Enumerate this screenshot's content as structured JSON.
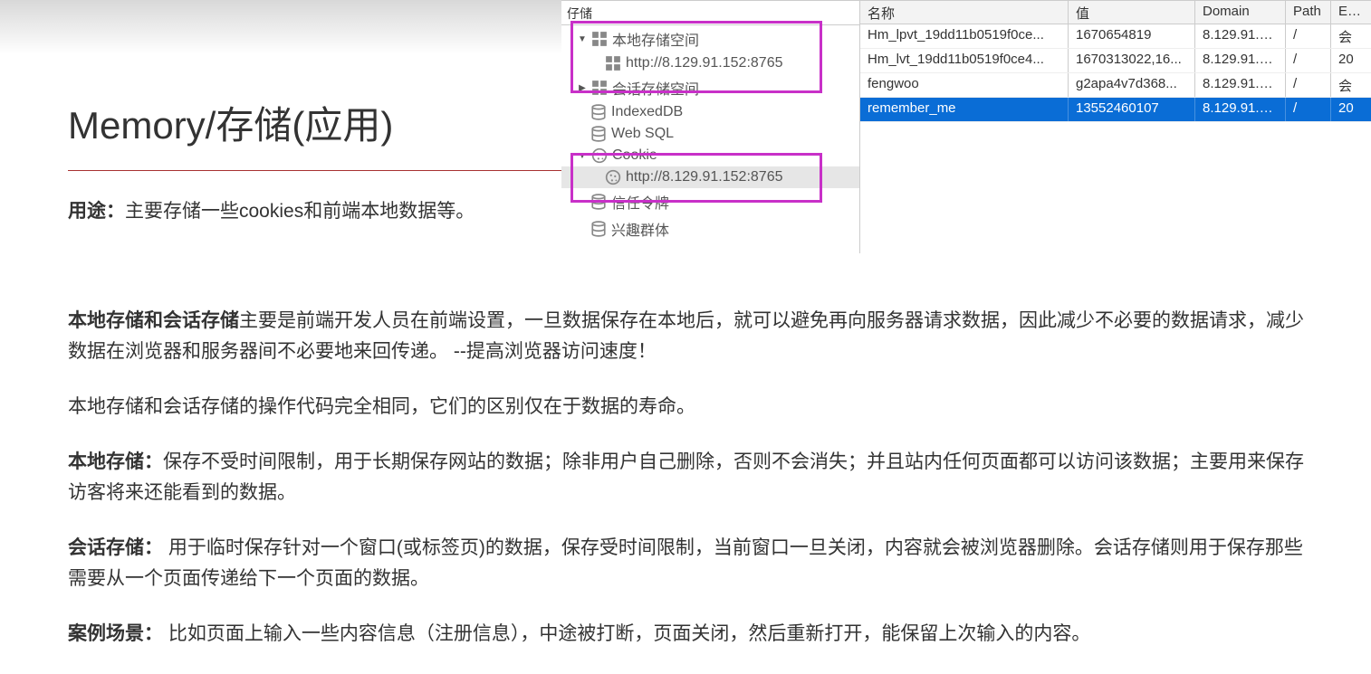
{
  "title": "Memory/存储(应用)",
  "paragraphs": {
    "p1_bold": "用途：",
    "p1_rest": "主要存储一些cookies和前端本地数据等。",
    "p2_bold": "本地存储和会话存储",
    "p2_rest": "主要是前端开发人员在前端设置，一旦数据保存在本地后，就可以避免再向服务器请求数据，因此减少不必要的数据请求，减少数据在浏览器和服务器间不必要地来回传递。 --提高浏览器访问速度！",
    "p3": "本地存储和会话存储的操作代码完全相同，它们的区别仅在于数据的寿命。",
    "p4_bold": "本地存储：",
    "p4_rest": "保存不受时间限制，用于长期保存网站的数据；除非用户自己删除，否则不会消失；并且站内任何页面都可以访问该数据；主要用来保存访客将来还能看到的数据。",
    "p5_bold": "会话存储：",
    "p5_rest": " 用于临时保存针对一个窗口(或标签页)的数据，保存受时间限制，当前窗口一旦关闭，内容就会被浏览器删除。会话存储则用于保存那些需要从一个页面传递给下一个页面的数据。",
    "p6_bold": "案例场景：",
    "p6_rest": " 比如页面上输入一些内容信息（注册信息），中途被打断，页面关闭，然后重新打开，能保留上次输入的内容。"
  },
  "tree": {
    "tab": "仔储",
    "local_storage": "本地存储空间",
    "local_storage_url": "http://8.129.91.152:8765",
    "session_storage": "会话存储空间",
    "indexeddb": "IndexedDB",
    "websql": "Web SQL",
    "cookie": "Cookie",
    "cookie_url": "http://8.129.91.152:8765",
    "trust_tokens": "信任令牌",
    "interest_groups": "兴趣群体"
  },
  "table": {
    "headers": {
      "name": "名称",
      "value": "值",
      "domain": "Domain",
      "path": "Path",
      "exp": "Exp"
    },
    "rows": [
      {
        "name": "Hm_lpvt_19dd11b0519f0ce...",
        "value": "1670654819",
        "domain": "8.129.91.1...",
        "path": "/",
        "exp": "会"
      },
      {
        "name": "Hm_lvt_19dd11b0519f0ce4...",
        "value": "1670313022,16...",
        "domain": "8.129.91.1...",
        "path": "/",
        "exp": "20"
      },
      {
        "name": "fengwoo",
        "value": "g2apa4v7d368...",
        "domain": "8.129.91.1...",
        "path": "/",
        "exp": "会"
      },
      {
        "name": "remember_me",
        "value": "13552460107",
        "domain": "8.129.91.1...",
        "path": "/",
        "exp": "20"
      }
    ]
  }
}
